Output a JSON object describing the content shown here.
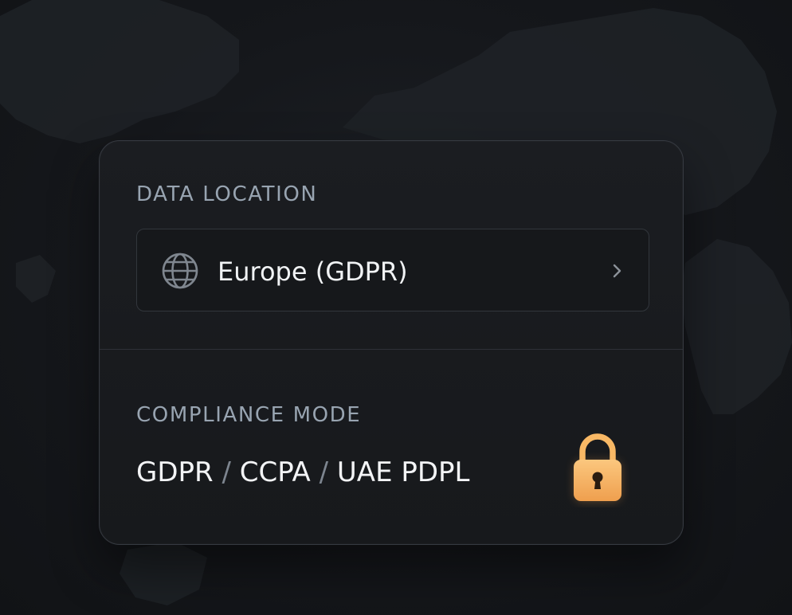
{
  "data_location": {
    "label": "DATA LOCATION",
    "selected_region": "Europe (GDPR)",
    "region_icon": "globe-icon",
    "expand_icon": "chevron-right-icon"
  },
  "compliance_mode": {
    "label": "COMPLIANCE MODE",
    "modes": [
      "GDPR",
      "CCPA",
      "UAE PDPL"
    ],
    "separator": "/",
    "status_icon": "lock-icon"
  },
  "colors": {
    "accent_lock": "#f6b96b",
    "card_background": "#1a1c20",
    "label_text": "#98a4b1",
    "value_text": "#f1f3f5"
  }
}
